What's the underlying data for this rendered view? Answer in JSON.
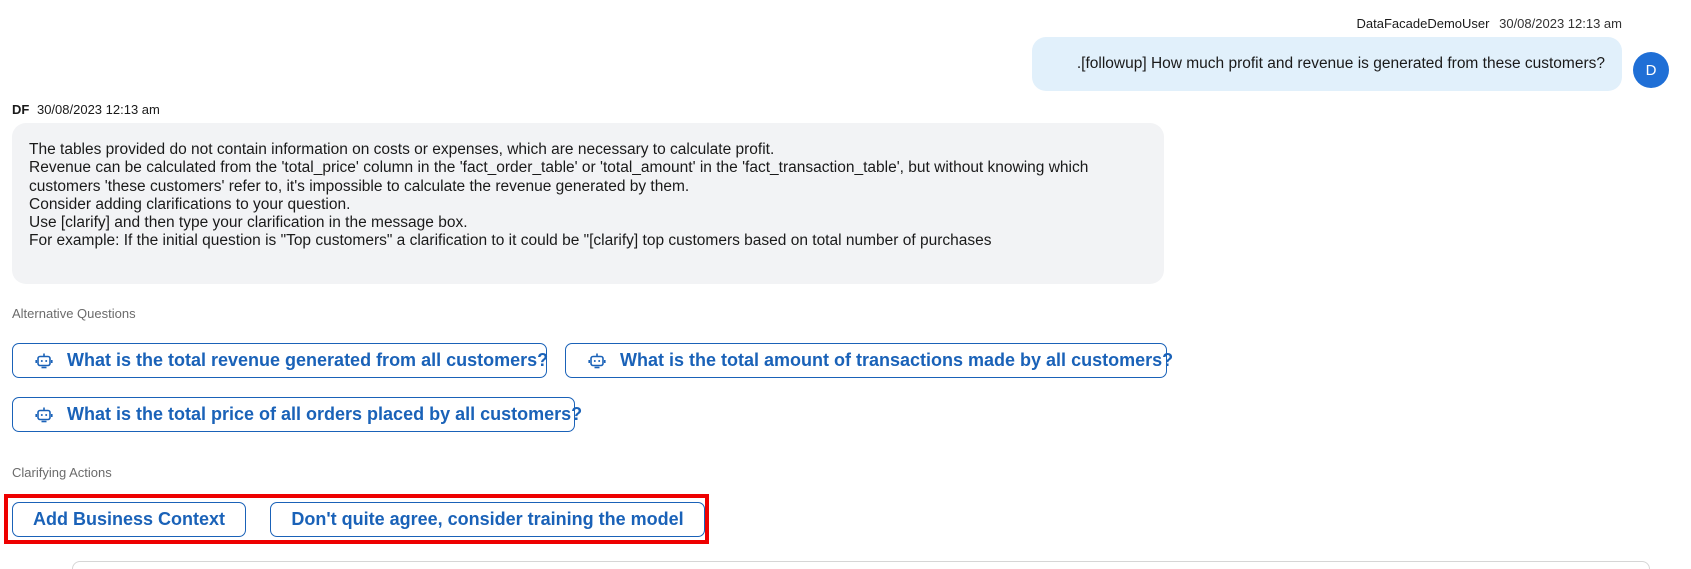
{
  "user_message": {
    "user_name": "DataFacadeDemoUser",
    "timestamp": "30/08/2023 12:13 am",
    "text": ".[followup] How much profit and revenue is generated from these customers?",
    "avatar_letter": "D"
  },
  "bot_message": {
    "sender": "DF",
    "timestamp": "30/08/2023 12:13 am",
    "lines": [
      "The tables provided do not contain information on costs or expenses, which are necessary to calculate profit.",
      "Revenue can be calculated from the 'total_price' column in the 'fact_order_table' or 'total_amount' in the 'fact_transaction_table', but without knowing which",
      "customers 'these customers' refer to, it's impossible to calculate the revenue generated by them.",
      "Consider adding clarifications to your question.",
      "Use [clarify] and then type your clarification in the message box.",
      "For example: If the initial question is \"Top customers\" a clarification to it could be \"[clarify] top customers based on total number of purchases"
    ]
  },
  "alternative_questions": {
    "label": "Alternative Questions",
    "icon": "robot-icon",
    "items": [
      "What is the total revenue generated from all customers?",
      "What is the total amount of transactions made by all customers?",
      "What is the total price of all orders placed by all customers?"
    ]
  },
  "clarifying_actions": {
    "label": "Clarifying Actions",
    "items": [
      "Add Business Context",
      "Don't quite agree, consider training the model"
    ]
  },
  "colors": {
    "accent": "#1a62b8",
    "user_bubble": "#e1f0fb",
    "bot_bubble": "#f2f3f5",
    "avatar": "#1f6fd6",
    "highlight": "#ee0000"
  }
}
